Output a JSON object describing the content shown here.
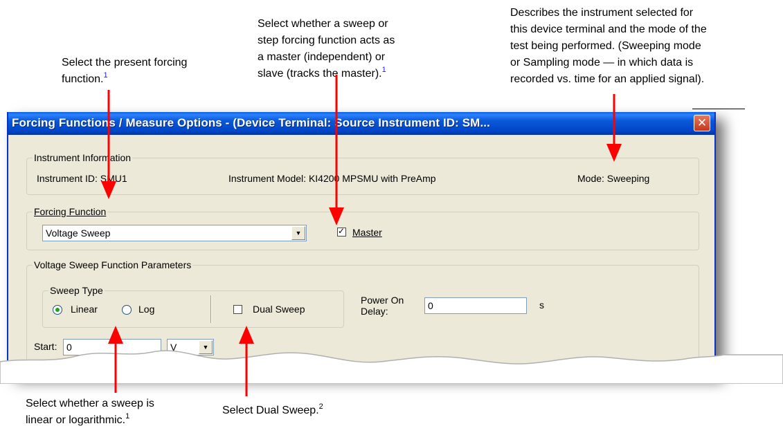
{
  "annotations": {
    "forcing_function": {
      "text": "Select the present forcing function.",
      "line1": "Select the present forcing",
      "line2": "function.",
      "footnote": "1"
    },
    "master_slave": {
      "line1": "Select whether a sweep or",
      "line2": "step forcing function acts as",
      "line3": "a master (independent) or",
      "line4": "slave (tracks the master).",
      "footnote": "1"
    },
    "mode": {
      "line1": "Describes the instrument selected for",
      "line2": "this device terminal and the mode of the",
      "line3": "test being performed. (Sweeping mode",
      "line4": "or Sampling mode — in which data is",
      "line5": "recorded vs. time for an applied signal)."
    },
    "sweep_linear": {
      "line1": "Select whether a sweep is",
      "line2": "linear or logarithmic.",
      "footnote": "1"
    },
    "dual_sweep": {
      "text": "Select Dual Sweep.",
      "footnote": "2"
    }
  },
  "dialog": {
    "title": "Forcing Functions / Measure Options - (Device Terminal: Source  Instrument ID: SM...",
    "close_glyph": "✕",
    "instrument_info": {
      "legend": "Instrument Information",
      "instrument_id": "Instrument ID:  SMU1",
      "instrument_model": "Instrument Model:  KI4200 MPSMU with PreAmp",
      "mode": "Mode:  Sweeping"
    },
    "forcing_function": {
      "legend": "Forcing Function",
      "selected": "Voltage Sweep",
      "master_label": "Master",
      "master_checked": true
    },
    "params": {
      "legend": "Voltage Sweep Function Parameters",
      "sweep_type_legend": "Sweep Type",
      "linear_label": "Linear",
      "log_label": "Log",
      "linear_selected": true,
      "dual_sweep_label": "Dual Sweep",
      "dual_sweep_checked": false,
      "power_on_label_1": "Power On",
      "power_on_label_2": "Delay:",
      "power_on_value": "0",
      "power_on_unit": "s",
      "start_label": "Start:",
      "start_value": "0",
      "start_unit": "V"
    }
  },
  "colors": {
    "arrow": "#ff0000",
    "title_bar": "#0a58d8",
    "footnote": "#1a1aff"
  }
}
